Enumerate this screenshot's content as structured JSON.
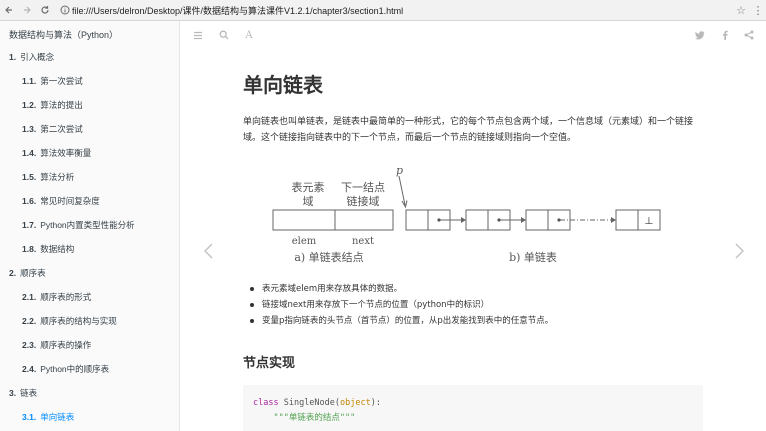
{
  "browser": {
    "url": "file:///Users/delron/Desktop/课件/数据结构与算法课件V1.2.1/chapter3/section1.html"
  },
  "sidebar": {
    "title": "数据结构与算法（Python）",
    "items": [
      {
        "num": "1.",
        "label": "引入概念",
        "level": 1
      },
      {
        "num": "1.1.",
        "label": "第一次尝试",
        "level": 2
      },
      {
        "num": "1.2.",
        "label": "算法的提出",
        "level": 2
      },
      {
        "num": "1.3.",
        "label": "第二次尝试",
        "level": 2
      },
      {
        "num": "1.4.",
        "label": "算法效率衡量",
        "level": 2
      },
      {
        "num": "1.5.",
        "label": "算法分析",
        "level": 2
      },
      {
        "num": "1.6.",
        "label": "常见时间复杂度",
        "level": 2
      },
      {
        "num": "1.7.",
        "label": "Python内置类型性能分析",
        "level": 2
      },
      {
        "num": "1.8.",
        "label": "数据结构",
        "level": 2
      },
      {
        "num": "2.",
        "label": "顺序表",
        "level": 1
      },
      {
        "num": "2.1.",
        "label": "顺序表的形式",
        "level": 2
      },
      {
        "num": "2.2.",
        "label": "顺序表的结构与实现",
        "level": 2
      },
      {
        "num": "2.3.",
        "label": "顺序表的操作",
        "level": 2
      },
      {
        "num": "2.4.",
        "label": "Python中的顺序表",
        "level": 2
      },
      {
        "num": "3.",
        "label": "链表",
        "level": 1
      },
      {
        "num": "3.1.",
        "label": "单向链表",
        "level": 2,
        "active": true
      }
    ]
  },
  "toolbar": {
    "icons": [
      "menu-icon",
      "search-icon",
      "font-icon",
      "twitter-icon",
      "facebook-icon",
      "share-icon"
    ],
    "font_glyph": "A"
  },
  "content": {
    "title": "单向链表",
    "intro": "单向链表也叫单链表，是链表中最简单的一种形式，它的每个节点包含两个域，一个信息域（元素域）和一个链接域。这个链接指向链表中的下一个节点，而最后一个节点的链接域则指向一个空值。",
    "figure": {
      "label_elem_top_1": "表元素",
      "label_elem_top_2": "域",
      "label_next_top_1": "下一结点",
      "label_next_top_2": "链接域",
      "label_elem": "elem",
      "label_next": "next",
      "caption_a": "a) 单链表结点",
      "caption_b": "b) 单链表",
      "pointer_label": "p",
      "null_symbol": "⊥"
    },
    "bullets": [
      "表元素域elem用来存放具体的数据。",
      "链接域next用来存放下一个节点的位置（python中的标识）",
      "变量p指向链表的头节点（首节点）的位置，从p出发能找到表中的任意节点。"
    ],
    "section_heading": "节点实现",
    "code": {
      "kw_class": "class",
      "class_name": "SingleNode",
      "paren_open": "(",
      "base": "object",
      "paren_close": "):",
      "docstring": "\"\"\"单链表的结点\"\"\""
    }
  },
  "colors": {
    "active_link": "#008cff",
    "sidebar_bg": "#fafafa",
    "code_bg": "#f7f7f7"
  }
}
